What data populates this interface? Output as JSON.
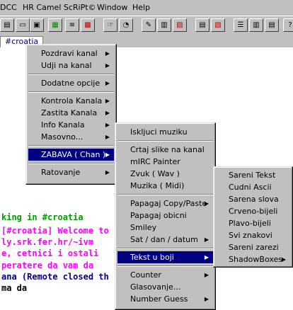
{
  "menubar": [
    {
      "label": "DCC"
    },
    {
      "label": "HR Camel ScRiPt©"
    },
    {
      "label": "Window"
    },
    {
      "label": "Help"
    }
  ],
  "toolbar_icons": [
    "script-icon",
    "window-icon",
    "cascade-icon",
    "list-icon",
    "green-script-icon",
    "colors-icon",
    "hand-icon",
    "timer-icon",
    "edit-icon",
    "notes-icon",
    "dcc-send-icon",
    "dcc-chat-icon",
    "options-icon",
    "url-icon",
    "tile-h-icon",
    "tile-v-icon",
    "cascade-windows-icon",
    "help-icon"
  ],
  "tab": {
    "label": "#croatia"
  },
  "chat_lines": [
    {
      "text": "king in #croatia",
      "color": "#00a000"
    },
    {
      "text": "[#croatia] Welcome to",
      "color": "#ff00ff"
    },
    {
      "text": "ly.srk.fer.hr/~ivm",
      "color": "#ff00ff"
    },
    {
      "text": "e, cetnici i ostali",
      "color": "#ff00ff"
    },
    {
      "text": "peratere da vam da",
      "color": "#ff00ff"
    },
    {
      "text": "ana (Remote closed th",
      "color": "#000080"
    },
    {
      "text": " ma da",
      "color": "#000000"
    }
  ],
  "menu1": {
    "items": [
      {
        "label": "Pozdravi kanal",
        "arrow": true
      },
      {
        "label": "Udji na kanal",
        "arrow": true
      },
      {
        "sep": true
      },
      {
        "label": "Dodatne opcije",
        "arrow": true
      },
      {
        "sep": true
      },
      {
        "label": "Kontrola Kanala",
        "arrow": true
      },
      {
        "label": "Zastita Kanala",
        "arrow": true
      },
      {
        "label": "Info Kanala",
        "arrow": true
      },
      {
        "label": "Masovno...",
        "arrow": true
      },
      {
        "sep": true
      },
      {
        "label": "ZABAVA ( Chan )",
        "arrow": true,
        "selected": true
      },
      {
        "sep": true
      },
      {
        "label": "Ratovanje",
        "arrow": true
      }
    ]
  },
  "menu2": {
    "items": [
      {
        "label": "Iskljuci muziku"
      },
      {
        "sep": true
      },
      {
        "label": "Crtaj slike na kanal"
      },
      {
        "label": "mIRC Painter"
      },
      {
        "label": "Zvuk  ( Wav )"
      },
      {
        "label": "Muzika ( Midi)"
      },
      {
        "sep": true
      },
      {
        "label": "Papagaj Copy/Paste",
        "arrow": true
      },
      {
        "label": "Papagaj obicni"
      },
      {
        "label": "Smiley"
      },
      {
        "label": "Sat / dan / datum",
        "arrow": true
      },
      {
        "sep": true
      },
      {
        "label": "Tekst u boji",
        "arrow": true,
        "selected": true
      },
      {
        "sep": true
      },
      {
        "label": "Counter",
        "arrow": true
      },
      {
        "label": "Glasovanje..."
      },
      {
        "label": "Number Guess",
        "arrow": true
      }
    ]
  },
  "menu3": {
    "items": [
      {
        "label": "Sareni Tekst"
      },
      {
        "label": "Cudni Ascii"
      },
      {
        "label": "Sarena slova"
      },
      {
        "label": "Crveno-bijeli"
      },
      {
        "label": "Plavo-bijeli"
      },
      {
        "label": "Svi znakovi"
      },
      {
        "label": "Sareni zarezi"
      },
      {
        "label": "ShadowBoxes",
        "arrow": true
      }
    ]
  }
}
